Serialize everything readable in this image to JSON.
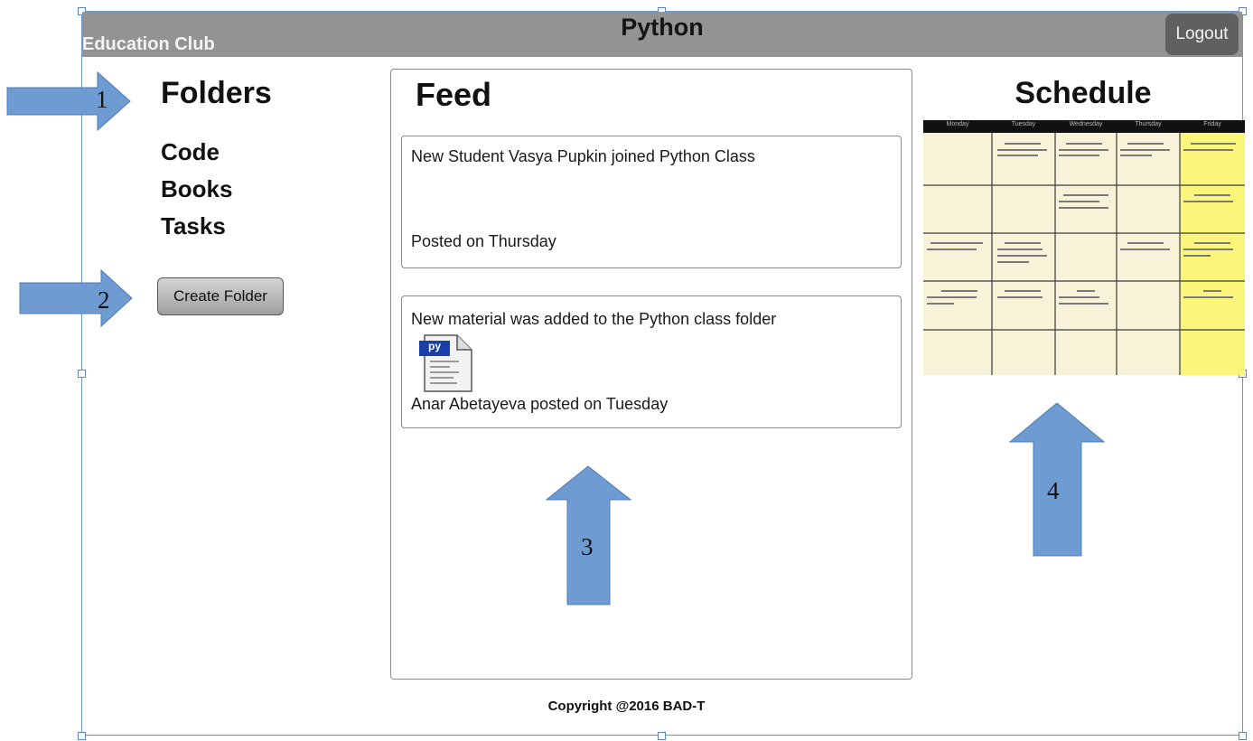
{
  "header": {
    "brand": "Education Club",
    "title": "Python",
    "logout_label": "Logout"
  },
  "folders": {
    "title": "Folders",
    "items": [
      "Code",
      "Books",
      "Tasks"
    ],
    "create_label": "Create Folder"
  },
  "feed": {
    "title": "Feed",
    "posts": [
      {
        "text": "New Student Vasya Pupkin joined Python Class",
        "footer": "Posted on Thursday"
      },
      {
        "text": "New material was added to the Python class folder",
        "attachment_label": "py",
        "footer": "Anar Abetayeva posted on Tuesday"
      }
    ]
  },
  "schedule": {
    "title": "Schedule",
    "days": [
      "Monday",
      "Tuesday",
      "Wednesday",
      "Thursday",
      "Friday"
    ]
  },
  "annotations": [
    "1",
    "2",
    "3",
    "4"
  ],
  "footer": "Copyright @2016 BAD-T",
  "colors": {
    "header_bg": "#939393",
    "logout_bg": "#606060",
    "arrow": "#6e9bd1",
    "schedule_highlight": "#fbf67a",
    "frame": "#6f98c8"
  }
}
